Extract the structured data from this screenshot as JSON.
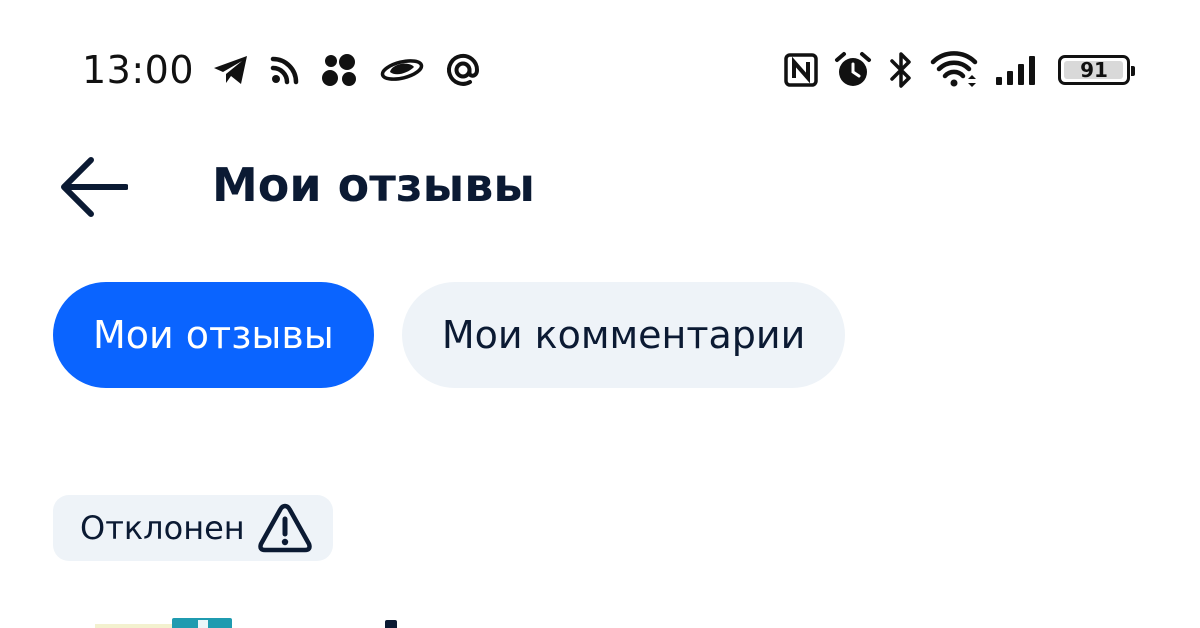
{
  "status_bar": {
    "time": "13:00",
    "notification_icons": [
      "telegram-icon",
      "rss-icon",
      "dots-cluster-icon",
      "planet-icon",
      "at-sign-icon"
    ],
    "system_icons": [
      "nfc-icon",
      "alarm-icon",
      "bluetooth-icon",
      "wifi-icon",
      "signal-icon"
    ],
    "battery": {
      "level": 91,
      "label": "91"
    }
  },
  "header": {
    "back_icon": "arrow-left-icon",
    "title": "Мои отзывы"
  },
  "tabs": [
    {
      "label": "Мои отзывы",
      "active": true
    },
    {
      "label": "Мои комментарии",
      "active": false
    }
  ],
  "review": {
    "status_label": "Отклонен",
    "status_icon": "warning-triangle-icon"
  },
  "colors": {
    "accent": "#0a64ff",
    "text_primary": "#0b1a33",
    "chip_background": "#eef3f8"
  }
}
